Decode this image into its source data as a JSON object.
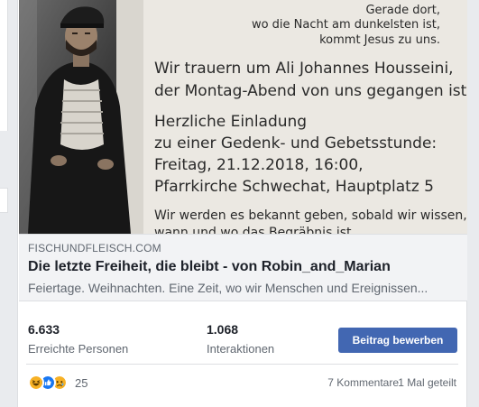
{
  "flyer": {
    "verse_1": "Gerade dort,",
    "verse_2": "wo die Nacht am dunkelsten ist,",
    "verse_3": "kommt Jesus zu uns.",
    "mourn_1": "Wir trauern um Ali Johannes Housseini,",
    "mourn_2": "der Montag-Abend von uns gegangen ist.",
    "invite_1": "Herzliche Einladung",
    "invite_2": "zu einer Gedenk- und Gebetsstunde:",
    "invite_3": "Freitag, 21.12.2018, 16:00,",
    "invite_4": "Pfarrkirche Schwechat, Hauptplatz 5",
    "note_1": "Wir werden es bekannt geben, sobald wir wissen,",
    "note_2": "wann und wo das Begräbnis ist"
  },
  "link": {
    "domain": "FISCHUNDFLEISCH.COM",
    "title": "Die letzte Freiheit, die bleibt - von Robin_and_Marian",
    "description": "Feiertage. Weihnachten. Eine Zeit, wo wir Menschen und Ereignissen..."
  },
  "insights": {
    "reach_value": "6.633",
    "reach_label": "Erreichte Personen",
    "engagement_value": "1.068",
    "engagement_label": "Interaktionen",
    "boost_label": "Beitrag bewerben"
  },
  "reactions": {
    "icons": [
      "haha-icon",
      "like-icon",
      "sad-icon"
    ],
    "count": "25",
    "comments": "7 Kommentare",
    "shares": "1 Mal geteilt"
  },
  "colors": {
    "boost_button": "#4267b2",
    "like": "#1877f2",
    "haha": "#f7b125",
    "sad": "#f7b125"
  }
}
